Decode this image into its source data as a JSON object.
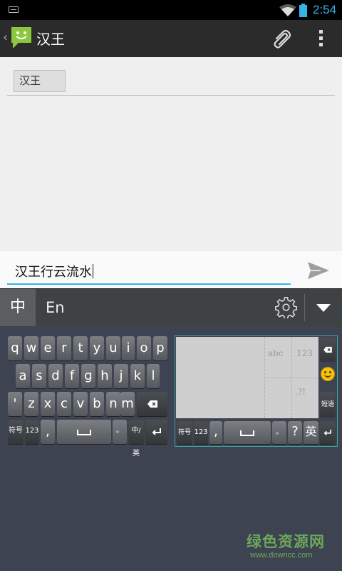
{
  "status": {
    "time": "2:54"
  },
  "action_bar": {
    "title": "汉王",
    "icons": [
      "app-icon",
      "paperclip-icon",
      "overflow-menu-icon"
    ]
  },
  "recipient": {
    "chip": "汉王"
  },
  "compose": {
    "text": "汉王行云流水"
  },
  "ime": {
    "tab_chinese": "中",
    "tab_english": "En",
    "icons": [
      "gear-icon",
      "collapse-icon"
    ]
  },
  "keyboard": {
    "row1": [
      "q",
      "w",
      "e",
      "r",
      "t",
      "y",
      "u",
      "i",
      "o",
      "p"
    ],
    "row2": [
      "a",
      "s",
      "d",
      "f",
      "g",
      "h",
      "j",
      "k",
      "l"
    ],
    "row3": [
      "'",
      "z",
      "x",
      "c",
      "v",
      "b",
      "n",
      "m"
    ],
    "row4": {
      "symbols": "符号",
      "num": "123",
      "comma": ",",
      "period": "。",
      "lang": "中/英"
    }
  },
  "handwriting": {
    "labels": {
      "abc": "abc",
      "num": "123",
      "punct": ",?!"
    },
    "bottom": {
      "symbols": "符号",
      "num": "123",
      "comma": ",",
      "period": "。",
      "question": "?",
      "lang": "英"
    },
    "side": {
      "phrase": "短语"
    }
  },
  "watermark": {
    "text": "绿色资源网",
    "url": "www.downcc.com"
  }
}
